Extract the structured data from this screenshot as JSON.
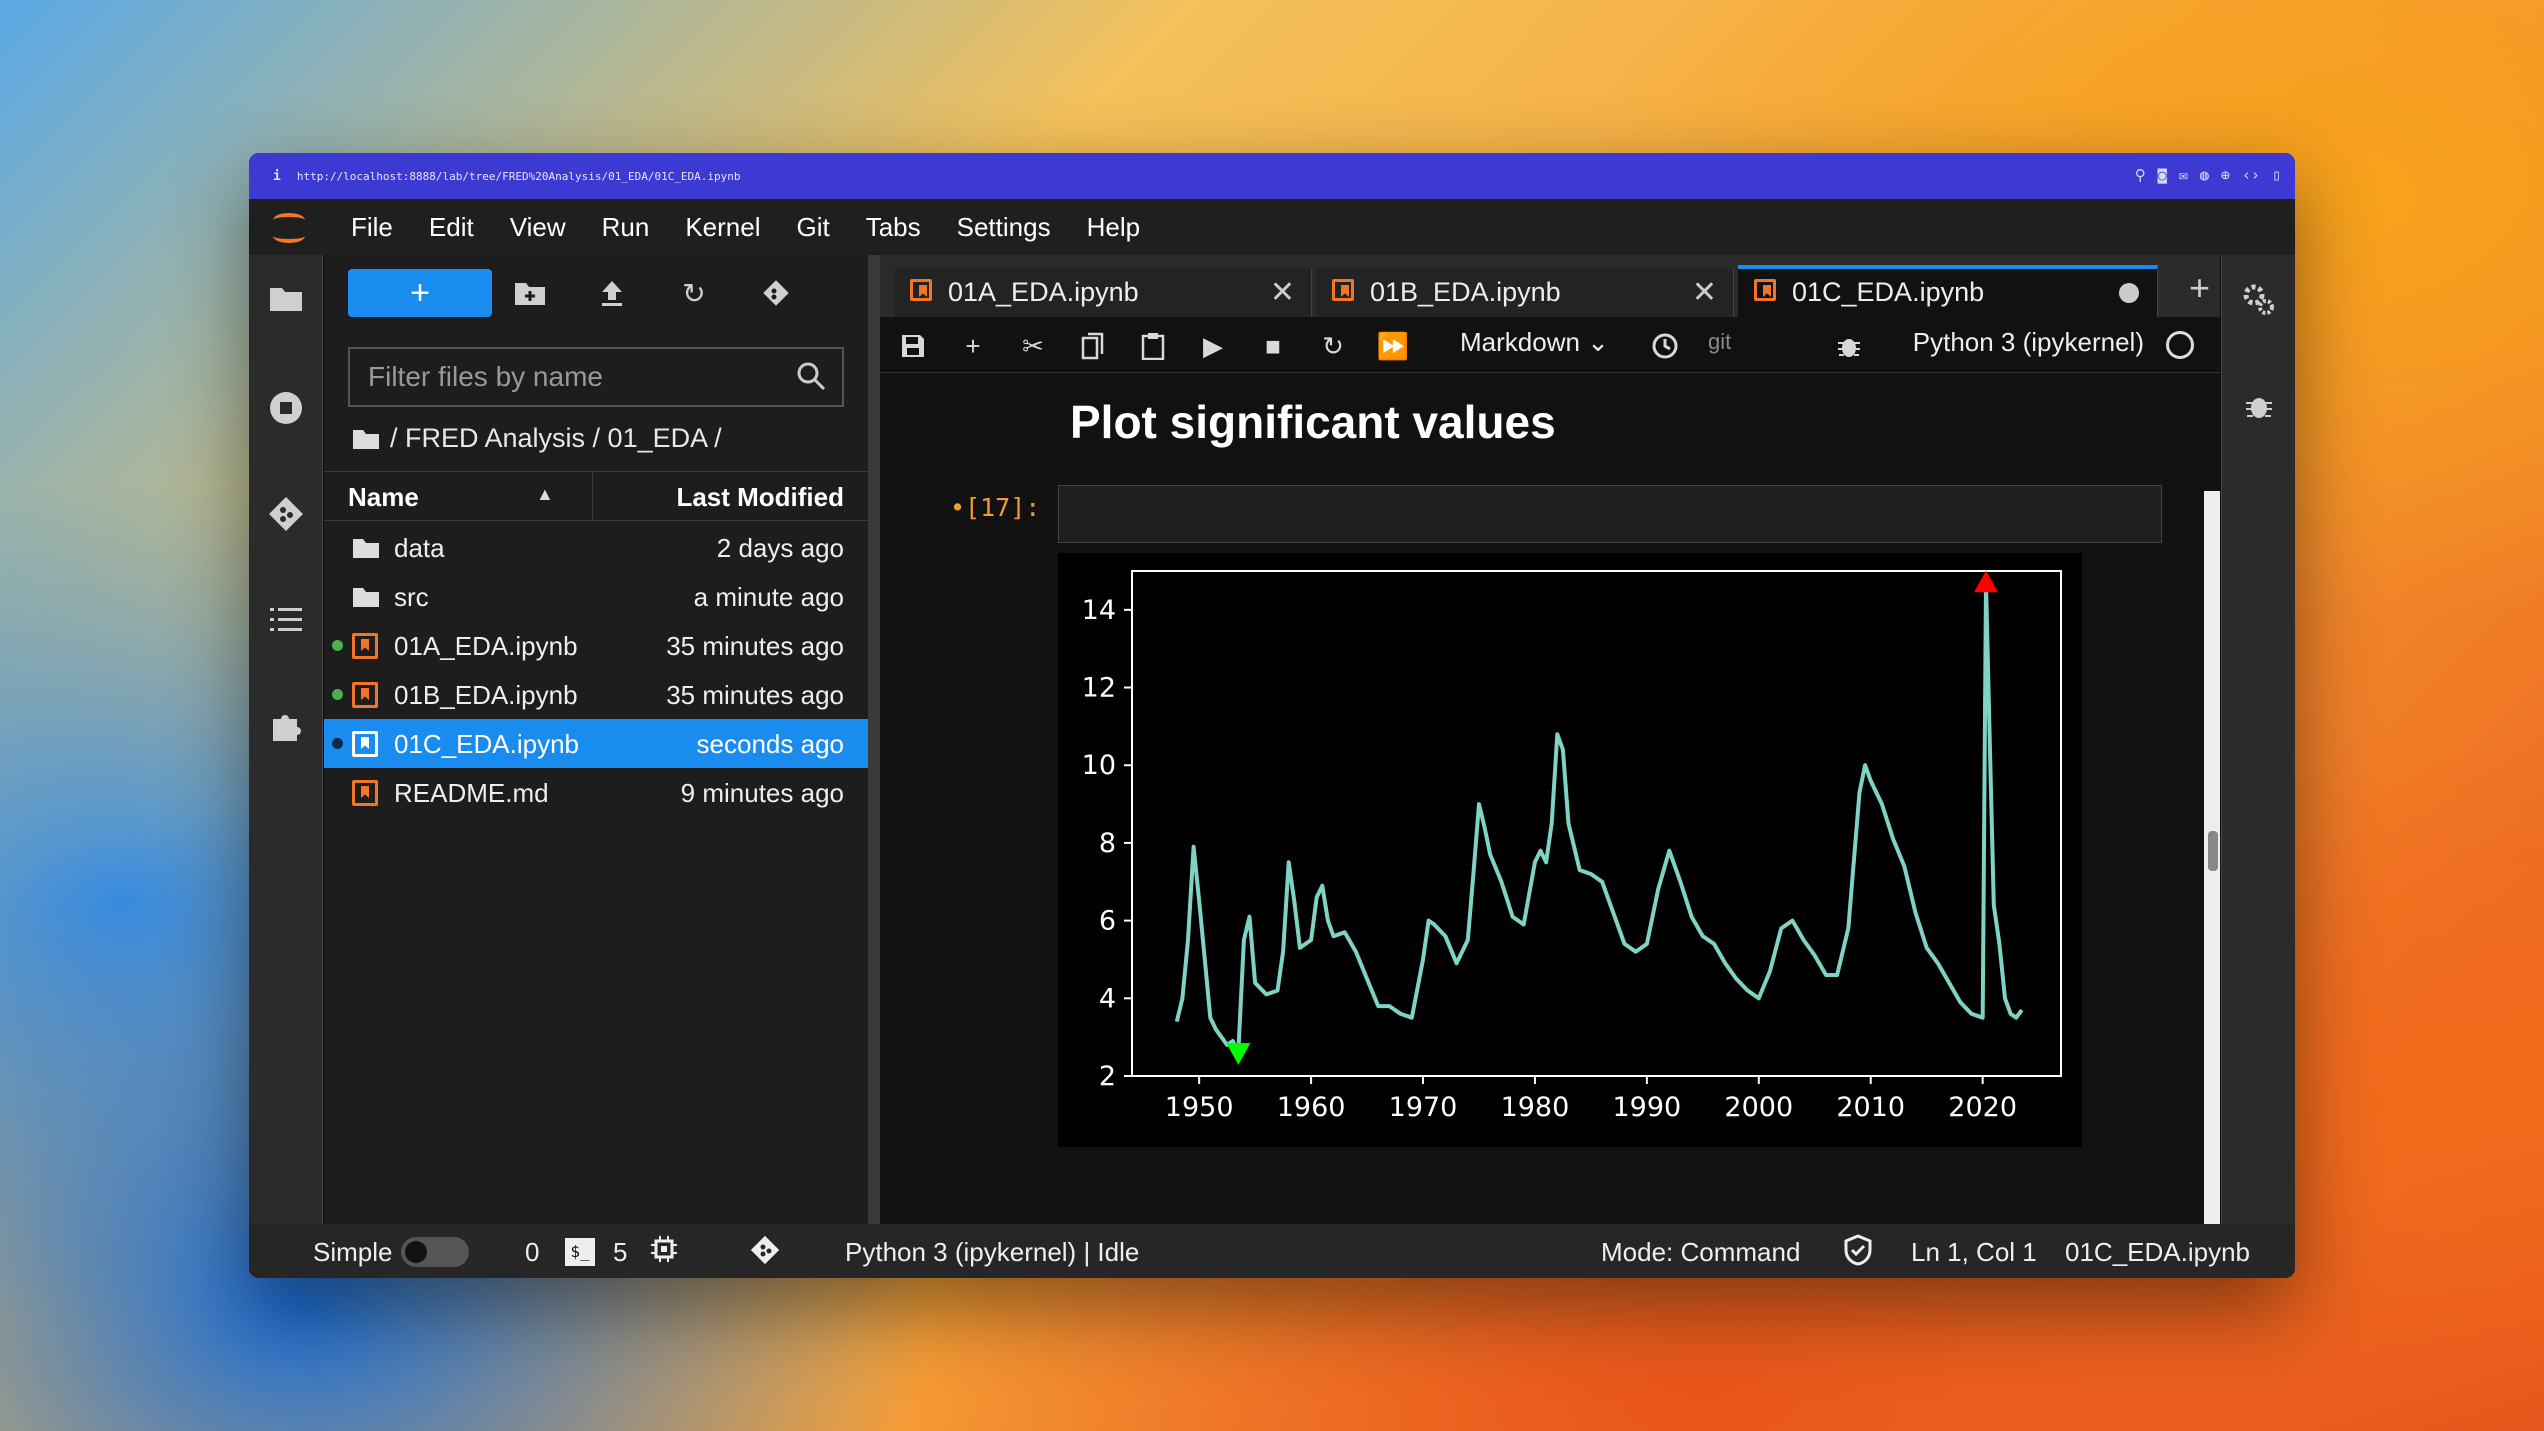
{
  "url": "http://localhost:8888/lab/tree/FRED%20Analysis/01_EDA/01C_EDA.ipynb",
  "menu": [
    "File",
    "Edit",
    "View",
    "Run",
    "Kernel",
    "Git",
    "Tabs",
    "Settings",
    "Help"
  ],
  "filebrowser": {
    "new_label": "+",
    "filter_placeholder": "Filter files by name",
    "breadcrumb": "/ FRED Analysis / 01_EDA /",
    "col_name": "Name",
    "col_modified": "Last Modified",
    "files": [
      {
        "name": "data",
        "modified": "2 days ago",
        "type": "folder",
        "running": false
      },
      {
        "name": "src",
        "modified": "a minute ago",
        "type": "folder",
        "running": false
      },
      {
        "name": "01A_EDA.ipynb",
        "modified": "35 minutes ago",
        "type": "notebook",
        "running": true
      },
      {
        "name": "01B_EDA.ipynb",
        "modified": "35 minutes ago",
        "type": "notebook",
        "running": true
      },
      {
        "name": "01C_EDA.ipynb",
        "modified": "seconds ago",
        "type": "notebook",
        "running": true,
        "selected": true
      },
      {
        "name": "README.md",
        "modified": "9 minutes ago",
        "type": "notebook",
        "running": false
      }
    ]
  },
  "tabs": [
    {
      "label": "01A_EDA.ipynb",
      "active": false
    },
    {
      "label": "01B_EDA.ipynb",
      "active": false
    },
    {
      "label": "01C_EDA.ipynb",
      "active": true
    }
  ],
  "toolbar": {
    "cell_type": "Markdown",
    "git": "git",
    "kernel": "Python 3 (ipykernel)"
  },
  "notebook": {
    "heading": "Plot significant values",
    "prompt": "•[17]:"
  },
  "chart_data": {
    "type": "line",
    "title": "",
    "xlabel": "",
    "ylabel": "",
    "xlim": [
      1944,
      2027
    ],
    "ylim": [
      2,
      15
    ],
    "xticks": [
      1950,
      1960,
      1970,
      1980,
      1990,
      2000,
      2010,
      2020
    ],
    "yticks": [
      2,
      4,
      6,
      8,
      10,
      12,
      14
    ],
    "series": [
      {
        "line_color": "#7fd3c4",
        "x": [
          1948,
          1948.5,
          1949,
          1949.5,
          1950,
          1950.5,
          1951,
          1951.5,
          1952,
          1952.5,
          1953,
          1953.5,
          1954,
          1954.5,
          1955,
          1956,
          1957,
          1957.5,
          1958,
          1958.5,
          1959,
          1960,
          1960.5,
          1961,
          1961.5,
          1962,
          1963,
          1964,
          1965,
          1966,
          1967,
          1968,
          1969,
          1970,
          1970.5,
          1971,
          1972,
          1973,
          1974,
          1974.5,
          1975,
          1975.5,
          1976,
          1977,
          1978,
          1979,
          1980,
          1980.5,
          1981,
          1981.5,
          1982,
          1982.5,
          1983,
          1984,
          1985,
          1986,
          1987,
          1988,
          1989,
          1990,
          1991,
          1992,
          1993,
          1994,
          1995,
          1996,
          1997,
          1998,
          1999,
          2000,
          2001,
          2002,
          2003,
          2004,
          2005,
          2006,
          2007,
          2008,
          2009,
          2009.5,
          2010,
          2011,
          2012,
          2013,
          2014,
          2015,
          2016,
          2017,
          2018,
          2019,
          2020,
          2020.3,
          2020.6,
          2021,
          2021.5,
          2022,
          2022.5,
          2023,
          2023.5
        ],
        "y": [
          3.4,
          4.0,
          5.5,
          7.9,
          6.5,
          5.0,
          3.5,
          3.2,
          3.0,
          2.8,
          2.9,
          2.6,
          5.5,
          6.1,
          4.4,
          4.1,
          4.2,
          5.2,
          7.5,
          6.5,
          5.3,
          5.5,
          6.6,
          6.9,
          6.0,
          5.6,
          5.7,
          5.2,
          4.5,
          3.8,
          3.8,
          3.6,
          3.5,
          5.0,
          6.0,
          5.9,
          5.6,
          4.9,
          5.5,
          7.2,
          9.0,
          8.4,
          7.7,
          7.0,
          6.1,
          5.9,
          7.5,
          7.8,
          7.5,
          8.5,
          10.8,
          10.4,
          8.5,
          7.3,
          7.2,
          7.0,
          6.2,
          5.4,
          5.2,
          5.4,
          6.8,
          7.8,
          7.0,
          6.1,
          5.6,
          5.4,
          4.9,
          4.5,
          4.2,
          4.0,
          4.7,
          5.8,
          6.0,
          5.5,
          5.1,
          4.6,
          4.6,
          5.8,
          9.3,
          10.0,
          9.6,
          9.0,
          8.1,
          7.4,
          6.2,
          5.3,
          4.9,
          4.4,
          3.9,
          3.6,
          3.5,
          14.7,
          11.0,
          6.4,
          5.4,
          4.0,
          3.6,
          3.5,
          3.7
        ]
      }
    ],
    "markers": [
      {
        "label": "max",
        "x": 2020.3,
        "y": 14.7,
        "symbol": "triangle-up",
        "color": "#ff0000"
      },
      {
        "label": "min",
        "x": 1953.5,
        "y": 2.6,
        "symbol": "triangle-down",
        "color": "#00ff00"
      }
    ]
  },
  "statusbar": {
    "mode_label": "Simple",
    "terminals": "0",
    "kernels": "5",
    "kernel_status": "Python 3 (ipykernel) | Idle",
    "mode": "Mode: Command",
    "position": "Ln 1, Col 1",
    "file": "01C_EDA.ipynb"
  },
  "colors": {
    "accent": "#1a8cf0",
    "jupyter_orange": "#f37626",
    "url_bar": "#3d3ad4",
    "running_dot": "#4caf50"
  }
}
